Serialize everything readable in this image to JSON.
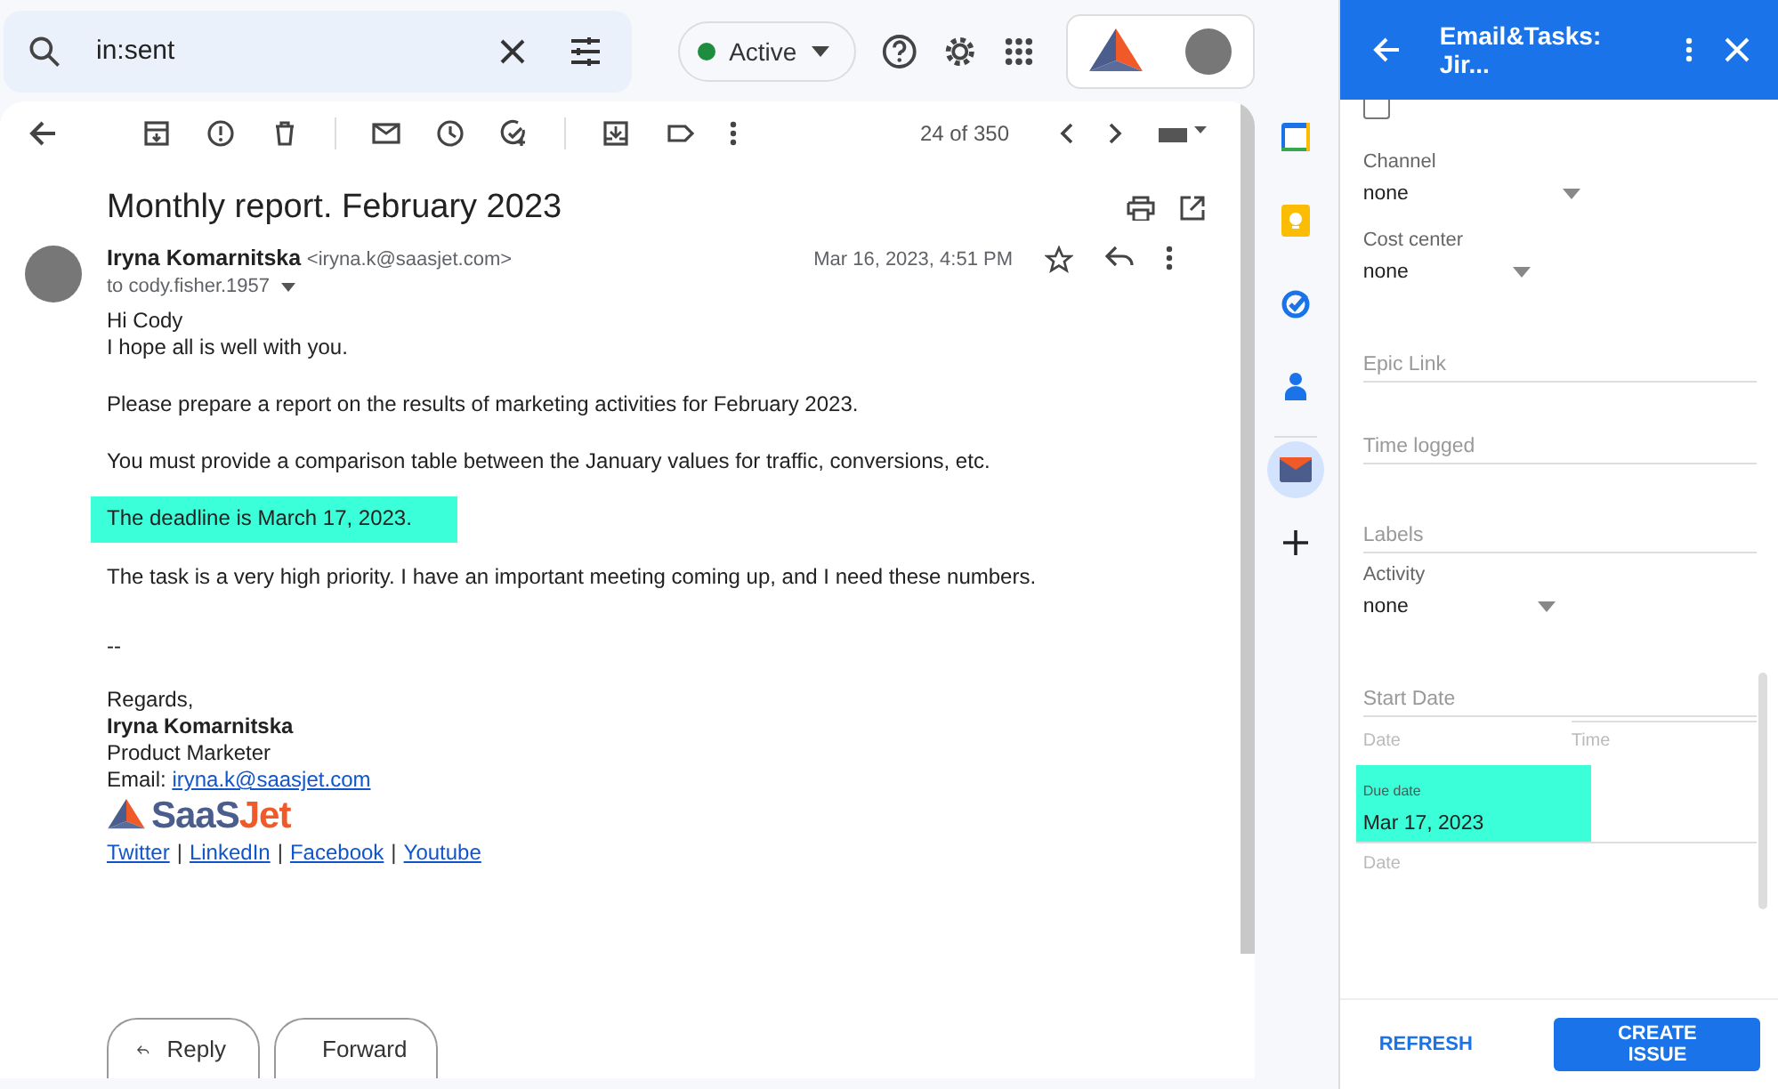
{
  "search": {
    "value": "in:sent"
  },
  "status": {
    "label": "Active",
    "on": true
  },
  "toolbar": {
    "counter": "24 of 350"
  },
  "email": {
    "subject": "Monthly report. February 2023",
    "sender_name": "Iryna Komarnitska",
    "sender_email": "<iryna.k@saasjet.com>",
    "recipient": "to cody.fisher.1957",
    "date": "Mar 16, 2023, 4:51 PM",
    "paragraphs": [
      {
        "lines": [
          "Hi Cody",
          "I hope all is well with you."
        ],
        "highlighted": false
      },
      {
        "lines": [
          "Please prepare a report on the results of marketing activities for February 2023."
        ],
        "highlighted": false
      },
      {
        "lines": [
          "You must provide a comparison table between the January values for traffic, conversions, etc."
        ],
        "highlighted": false
      },
      {
        "lines": [
          "The deadline is March 17, 2023."
        ],
        "highlighted": true
      },
      {
        "lines": [
          "The task is a very high priority. I have an important meeting coming up, and I need these numbers."
        ],
        "highlighted": false
      }
    ],
    "signature": {
      "dash": "--",
      "closing": "Regards,",
      "name": "Iryna Komarnitska",
      "title": "Product Marketer",
      "email_label": "Email:",
      "email_link": "iryna.k@saasjet.com",
      "logo_left": "SaaS",
      "logo_right": "Jet",
      "links": [
        "Twitter",
        "LinkedIn",
        "Facebook",
        "Youtube"
      ],
      "separator": "|"
    },
    "actions": [
      "Reply",
      "Forward"
    ]
  },
  "panel": {
    "title": "Email&Tasks: Jir...",
    "general_checkbox": {
      "checked": false
    },
    "fields": [
      {
        "kind": "select",
        "label": "Channel",
        "value": "none"
      },
      {
        "kind": "select",
        "label": "Cost center",
        "value": "none"
      },
      {
        "kind": "text",
        "placeholder": "Epic Link"
      },
      {
        "kind": "text",
        "placeholder": "Time logged"
      },
      {
        "kind": "text",
        "placeholder": "Labels"
      },
      {
        "kind": "select",
        "label": "Activity",
        "value": "none"
      },
      {
        "kind": "datetime",
        "placeholder": "Start Date",
        "date_hint": "Date",
        "time_hint": "Time"
      },
      {
        "kind": "date",
        "label": "Due date",
        "value": "Mar 17, 2023",
        "date_hint": "Date",
        "highlighted": true
      }
    ],
    "buttons": [
      {
        "label": "REFRESH",
        "kind": "flat"
      },
      {
        "label": "CREATE ISSUE",
        "kind": "raised"
      }
    ]
  }
}
